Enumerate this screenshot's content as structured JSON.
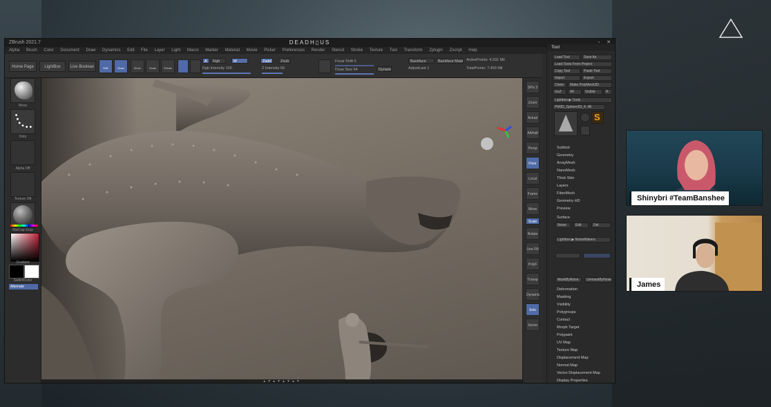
{
  "window": {
    "app_name": "ZBrush 2021.7",
    "center_title": "DEADH▯US",
    "controls": [
      "_",
      "▫",
      "✕"
    ]
  },
  "menu": [
    "Alpha",
    "Brush",
    "Color",
    "Document",
    "Draw",
    "Dynamics",
    "Edit",
    "File",
    "Layer",
    "Light",
    "Macro",
    "Marker",
    "Material",
    "Movie",
    "Picker",
    "Preferences",
    "Render",
    "Stencil",
    "Stroke",
    "Texture",
    "Tool",
    "Transform",
    "Zplugin",
    "Zscript",
    "Help"
  ],
  "toolbar": {
    "home_page": "Home Page",
    "lightbox": "LightBox",
    "live_boolean": "Live Boolean",
    "icons": [
      "Edit",
      "Draw",
      "Move",
      "Scale",
      "Rotate"
    ],
    "mrgb": "A",
    "rgb": "Rgb",
    "m": "M",
    "zadd": "Zadd",
    "zsub": "Zsub",
    "rgb_intensity": "Rgb Intensity 100",
    "z_intensity": "Z Intensity 50",
    "focal_shift": "Focal Shift 0",
    "draw_size": "Draw Size 64",
    "dynamic": "Dynamic",
    "backface": "Backface",
    "backface_mask": "Backface Mask",
    "active_points": "ActivePoints: 4.931 Mil",
    "adjust_last": "AdjustLast 1",
    "total_points": "TotalPoints: 7.450 Mil"
  },
  "left_tray": {
    "brush_label": "Move",
    "stroke_label": "Dots",
    "alpha_label": "Alpha Off",
    "texture_label": "Texture Off",
    "material_label": "MatCap Gray",
    "gradient_label": "Gradient",
    "switch_label": "SwitchColor",
    "alternate_label": "Alternate"
  },
  "canvas": {
    "bottom_label": "▲▼▲▼▲▼▲▼"
  },
  "icon_column": [
    "SPix 3",
    "Zoom",
    "Actual",
    "AAHalf",
    "Persp",
    "Floor",
    "Local",
    "Frame",
    "Move",
    "Scale",
    "Rotate",
    "Line Fill",
    "PolyF",
    "Transp",
    "Dynamic",
    "Solo",
    "Xpose"
  ],
  "tool_panel": {
    "header": "Tool",
    "buttons": [
      [
        "Load Tool",
        "Save As"
      ],
      [
        "Load Tools From Project"
      ],
      [
        "Copy Tool",
        "Paste Tool"
      ],
      [
        "Import",
        "Export"
      ],
      [
        "Clone",
        "Make PolyMesh3D"
      ],
      [
        "GoZ",
        "All",
        "Visible",
        "R"
      ]
    ],
    "lightbox_tools": "Lightbox ▶ Tools",
    "current_tool": "PM3D_Sphere3D_4. 48",
    "subpanels": [
      "Subtool",
      "Geometry",
      "ArrayMesh",
      "NanoMesh",
      "Thick Skin",
      "Layers",
      "FiberMesh",
      "Geometry HD",
      "Preview"
    ],
    "surface_header": "Surface",
    "surface_buttons": [
      "Noise",
      "Edit",
      "Del"
    ],
    "lightbox_noise": "Lightbox ▶ NoiseMakers",
    "deformation_buttons": [
      "MaskByNoise",
      "UnmaskByNoise"
    ],
    "lower_items": [
      "Deformation",
      "Masking",
      "Visibility",
      "Polygroups",
      "Contact",
      "Morph Target",
      "Polypaint",
      "UV Map",
      "Texture Map",
      "Displacement Map",
      "Normal Map",
      "Vector Displacement Map",
      "Display Properties"
    ]
  },
  "cams": {
    "cam1_name": "Shinybri #TeamBanshee",
    "cam2_name": "James"
  },
  "colors": {
    "accent_blue": "#4f6aa6",
    "highlight_orange": "#b37b2a",
    "primary_color": "#000000",
    "secondary_color": "#ffffff"
  }
}
